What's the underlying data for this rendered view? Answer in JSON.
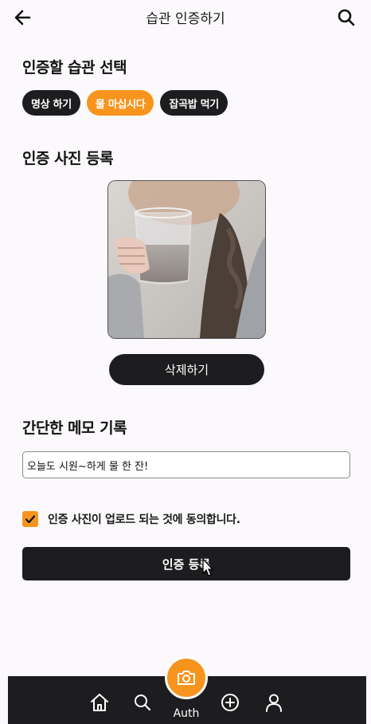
{
  "header": {
    "title": "습관 인증하기",
    "back_icon": "arrow-left-icon",
    "search_icon": "search-icon"
  },
  "habit_section": {
    "title": "인증할 습관 선택",
    "chips": [
      {
        "label": "명상 하기",
        "selected": false
      },
      {
        "label": "물 마십시다",
        "selected": true
      },
      {
        "label": "잡곡밥 먹기",
        "selected": false
      }
    ]
  },
  "photo_section": {
    "title": "인증 사진 등록",
    "delete_label": "삭제하기"
  },
  "memo_section": {
    "title": "간단한 메모 기록",
    "value": "오늘도 시원~하게 물 한 잔!"
  },
  "agreement": {
    "checked": true,
    "label": "인증 사진이 업로드 되는 것에 동의합니다."
  },
  "submit_label": "인증 등록",
  "bottom_nav": {
    "items": [
      "home-icon",
      "search-icon",
      "camera-icon",
      "plus-circle-icon",
      "user-icon"
    ],
    "active_label": "Auth"
  },
  "colors": {
    "accent": "#f7941d",
    "dark": "#1d1d1f",
    "background": "#fbf9fb"
  }
}
